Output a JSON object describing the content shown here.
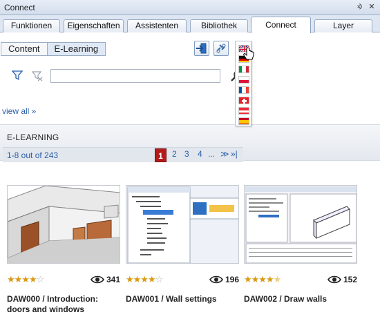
{
  "window": {
    "title": "Connect",
    "pin_glyph": "⨵",
    "close_glyph": "✕"
  },
  "tabs": [
    {
      "label": "Funktionen",
      "active": false
    },
    {
      "label": "Eigenschaften",
      "active": false
    },
    {
      "label": "Assistenten",
      "active": false
    },
    {
      "label": "Bibliothek",
      "active": false
    },
    {
      "label": "Connect",
      "active": true
    },
    {
      "label": "Layer",
      "active": false
    }
  ],
  "view_toggle": {
    "content_label": "Content",
    "elearning_label": "E-Learning",
    "selected": "E-Learning"
  },
  "search": {
    "value": "",
    "placeholder": ""
  },
  "view_all_label": "view all »",
  "language_flags": [
    "uk",
    "germany",
    "italy",
    "poland",
    "france",
    "switzerland",
    "austria",
    "spain"
  ],
  "elearning": {
    "heading": "E-LEARNING",
    "range_text": "1-8 out of 243",
    "pages": [
      "1",
      "2",
      "3",
      "4",
      "..."
    ],
    "current_page": "1",
    "next_glyph": "≫",
    "last_glyph": "»|"
  },
  "cards": [
    {
      "code_title": "DAW000 / Introduction: doors and windows",
      "rating": 4,
      "views": "341"
    },
    {
      "code_title": "DAW001 / Wall settings",
      "rating": 4,
      "views": "196"
    },
    {
      "code_title": "DAW002 / Draw walls",
      "rating": 4.5,
      "views": "152"
    }
  ],
  "colors": {
    "accent": "#2a5fa8",
    "current_page": "#b31b1b",
    "star": "#d89a12"
  }
}
